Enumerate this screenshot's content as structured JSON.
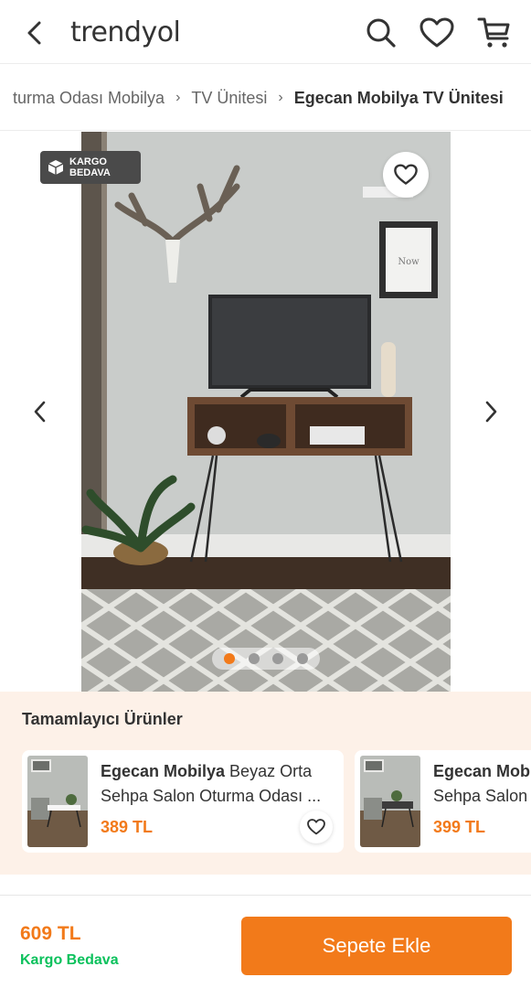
{
  "header": {
    "logo": "trendyol",
    "back_icon": "chevron-left-icon",
    "search_icon": "search-icon",
    "favorites_icon": "heart-icon",
    "cart_icon": "cart-icon"
  },
  "breadcrumb": {
    "items": [
      "turma Odası Mobilya",
      "TV Ünitesi"
    ],
    "current": "Egecan Mobilya TV Ünitesi"
  },
  "gallery": {
    "badge_line1": "KARGO",
    "badge_line2": "BEDAVA",
    "image_count": 4,
    "active_index": 0
  },
  "complementary": {
    "title": "Tamamlayıcı Ürünler",
    "products": [
      {
        "brand": "Egecan Mobilya",
        "name": " Beyaz Orta Sehpa Salon Oturma Odası ...",
        "price": "389 TL"
      },
      {
        "brand": "Egecan Mob",
        "name": "Sehpa Salon",
        "price": "399 TL"
      }
    ]
  },
  "bottom_bar": {
    "price": "609 TL",
    "shipping": "Kargo Bedava",
    "add_to_cart": "Sepete Ekle"
  },
  "colors": {
    "brand_orange": "#f27a1a",
    "shipping_green": "#0bc15c",
    "complementary_bg": "#fdf1e8"
  }
}
